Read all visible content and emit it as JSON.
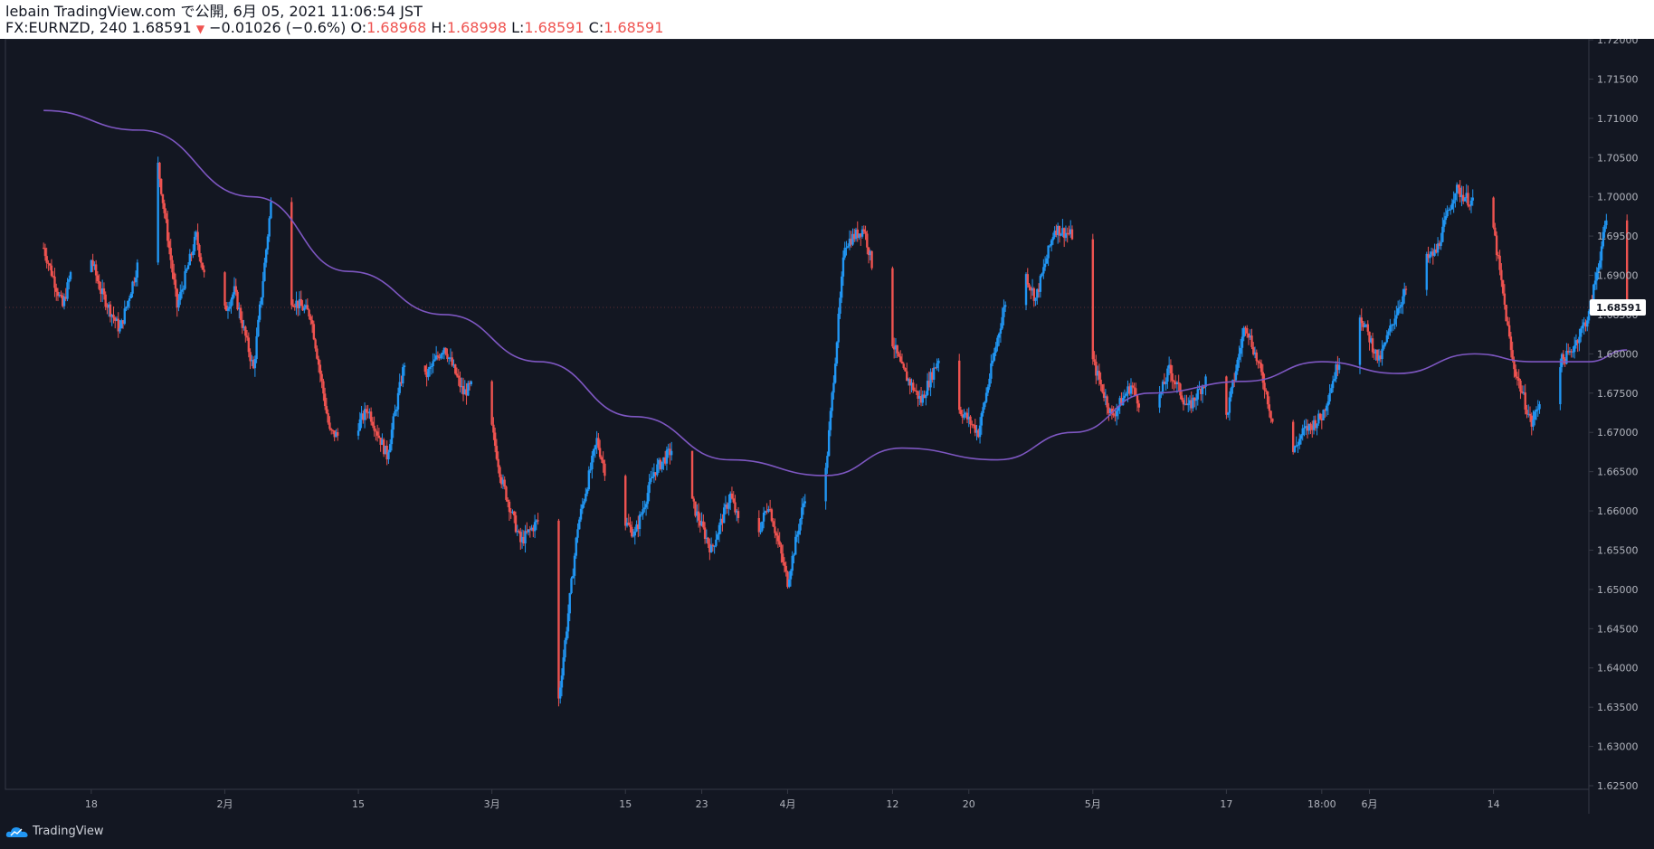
{
  "header": {
    "line1": "lebain TradingView.com で公開, 6月 05, 2021 11:06:54 JST",
    "symbol": "FX:EURNZD, 240",
    "last": "1.68591",
    "change": "−0.01026 (−0.6%)",
    "o_label": "O:",
    "o_value": "1.68968",
    "h_label": "H:",
    "h_value": "1.68998",
    "l_label": "L:",
    "l_value": "1.68591",
    "c_label": "C:",
    "c_value": "1.68591"
  },
  "footer": {
    "brand": "TradingView"
  },
  "colors": {
    "background": "#131722",
    "up": "#2196f3",
    "down": "#ef5350",
    "ma": "#7e57c2",
    "price_tag": "#131722"
  },
  "chart_data": {
    "type": "line",
    "subtype": "candlestick",
    "symbol": "FX:EURNZD",
    "timeframe": "240",
    "ylim": [
      1.625,
      1.72
    ],
    "y_ticks": [
      "1.72000",
      "1.71500",
      "1.71000",
      "1.70500",
      "1.70000",
      "1.69500",
      "1.69000",
      "1.68500",
      "1.68000",
      "1.67500",
      "1.67000",
      "1.66500",
      "1.66000",
      "1.65500",
      "1.65000",
      "1.64500",
      "1.64000",
      "1.63500",
      "1.63000",
      "1.62500"
    ],
    "x_ticks": [
      "18",
      "2月",
      "15",
      "3月",
      "15",
      "23",
      "4月",
      "12",
      "20",
      "5月",
      "17",
      "18:00",
      "6月",
      "14"
    ],
    "last_price": "1.68591",
    "series": [
      {
        "kind": "price",
        "points": [
          [
            "1/13",
            1.6935
          ],
          [
            "1/15",
            1.686
          ],
          [
            "1/17",
            1.696
          ],
          [
            "1/19",
            1.688
          ],
          [
            "1/21",
            1.683
          ],
          [
            "1/23",
            1.692
          ],
          [
            "1/25",
            1.704
          ],
          [
            "1/27",
            1.686
          ],
          [
            "1/29",
            1.695
          ],
          [
            "1/31",
            1.683
          ],
          [
            "2/2",
            1.688
          ],
          [
            "2/4",
            1.678
          ],
          [
            "2/6",
            1.701
          ],
          [
            "2/8",
            1.687
          ],
          [
            "2/10",
            1.685
          ],
          [
            "2/12",
            1.67
          ],
          [
            "2/14",
            1.669
          ],
          [
            "2/16",
            1.673
          ],
          [
            "2/18",
            1.667
          ],
          [
            "2/20",
            1.68
          ],
          [
            "2/22",
            1.677
          ],
          [
            "2/24",
            1.681
          ],
          [
            "2/26",
            1.675
          ],
          [
            "2/28",
            1.677
          ],
          [
            "3/2",
            1.664
          ],
          [
            "3/4",
            1.656
          ],
          [
            "3/6",
            1.659
          ],
          [
            "3/8",
            1.636
          ],
          [
            "3/10",
            1.658
          ],
          [
            "3/12",
            1.669
          ],
          [
            "3/14",
            1.66
          ],
          [
            "3/16",
            1.657
          ],
          [
            "3/18",
            1.665
          ],
          [
            "3/20",
            1.668
          ],
          [
            "3/22",
            1.661
          ],
          [
            "3/24",
            1.655
          ],
          [
            "3/26",
            1.662
          ],
          [
            "3/28",
            1.654
          ],
          [
            "3/30",
            1.661
          ],
          [
            "4/1",
            1.651
          ],
          [
            "4/3",
            1.663
          ],
          [
            "4/5",
            1.665
          ],
          [
            "4/7",
            1.694
          ],
          [
            "4/9",
            1.696
          ],
          [
            "4/11",
            1.685
          ],
          [
            "4/13",
            1.678
          ],
          [
            "4/15",
            1.674
          ],
          [
            "4/17",
            1.68
          ],
          [
            "4/19",
            1.673
          ],
          [
            "4/21",
            1.67
          ],
          [
            "4/23",
            1.682
          ],
          [
            "4/25",
            1.693
          ],
          [
            "4/27",
            1.687
          ],
          [
            "4/29",
            1.696
          ],
          [
            "5/1",
            1.695
          ],
          [
            "5/3",
            1.679
          ],
          [
            "5/5",
            1.672
          ],
          [
            "5/7",
            1.676
          ],
          [
            "5/9",
            1.671
          ],
          [
            "5/11",
            1.678
          ],
          [
            "5/13",
            1.673
          ],
          [
            "5/15",
            1.677
          ],
          [
            "5/17",
            1.672
          ],
          [
            "5/19",
            1.684
          ],
          [
            "5/21",
            1.676
          ],
          [
            "5/23",
            1.665
          ],
          [
            "5/25",
            1.67
          ],
          [
            "5/27",
            1.672
          ],
          [
            "5/29",
            1.68
          ],
          [
            "5/31",
            1.685
          ],
          [
            "6/2",
            1.679
          ],
          [
            "6/4",
            1.686
          ],
          [
            "6/6",
            1.691
          ],
          [
            "6/8",
            1.693
          ],
          [
            "6/10",
            1.701
          ],
          [
            "6/12",
            1.699
          ],
          [
            "6/14",
            1.696
          ],
          [
            "6/16",
            1.679
          ],
          [
            "6/18",
            1.671
          ],
          [
            "6/20",
            1.678
          ],
          [
            "6/22",
            1.68
          ],
          [
            "6/24",
            1.685
          ],
          [
            "6/26",
            1.698
          ],
          [
            "6/28",
            1.6859
          ]
        ]
      },
      {
        "kind": "moving_average",
        "points": [
          [
            "1/13",
            1.711
          ],
          [
            "1/23",
            1.7085
          ],
          [
            "2/4",
            1.7
          ],
          [
            "2/14",
            1.6905
          ],
          [
            "2/24",
            1.685
          ],
          [
            "3/6",
            1.679
          ],
          [
            "3/16",
            1.672
          ],
          [
            "3/26",
            1.6665
          ],
          [
            "4/5",
            1.6645
          ],
          [
            "4/13",
            1.668
          ],
          [
            "4/23",
            1.6665
          ],
          [
            "5/1",
            1.67
          ],
          [
            "5/9",
            1.675
          ],
          [
            "5/19",
            1.6765
          ],
          [
            "5/27",
            1.679
          ],
          [
            "6/4",
            1.6775
          ],
          [
            "6/12",
            1.68
          ],
          [
            "6/18",
            1.679
          ],
          [
            "6/24",
            1.679
          ],
          [
            "6/28",
            1.6805
          ]
        ]
      }
    ]
  }
}
